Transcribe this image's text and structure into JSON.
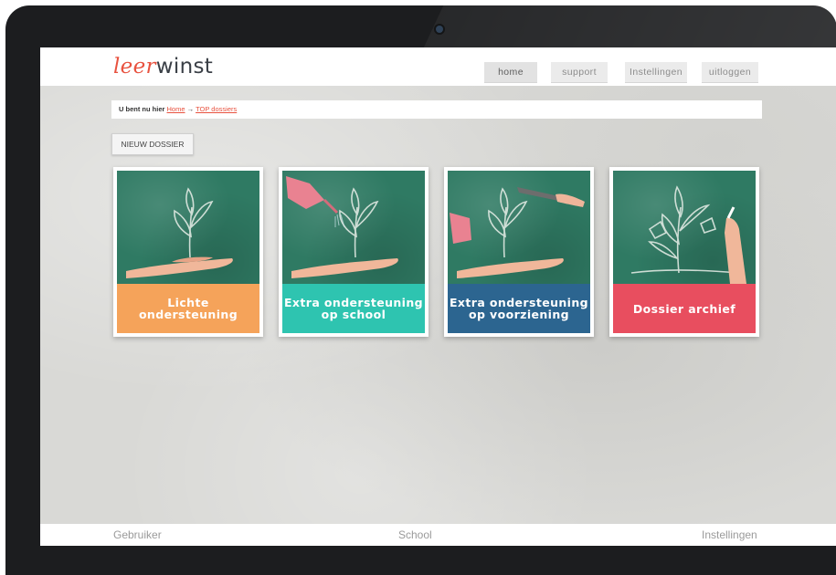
{
  "logo": {
    "accent": "leer",
    "rest": "winst"
  },
  "nav": {
    "home": "home",
    "support": "support",
    "instellingen": "Instellingen",
    "uitloggen": "uitloggen"
  },
  "breadcrumb": {
    "prefix": "U bent nu hier",
    "home_link": "Home",
    "arrow": "→",
    "current_link": "TOP dossiers"
  },
  "actions": {
    "new_dossier": "NIEUW DOSSIER"
  },
  "tiles": [
    {
      "line1": "Lichte ondersteuning",
      "line2": "",
      "color": "#f5a35a"
    },
    {
      "line1": "Extra ondersteuning",
      "line2": "op school",
      "color": "#2ec4b0"
    },
    {
      "line1": "Extra ondersteuning",
      "line2": "op voorziening",
      "color": "#2c6590"
    },
    {
      "line1": "Dossier archief",
      "line2": "",
      "color": "#e84e5f"
    }
  ],
  "footer": {
    "gebruiker": "Gebruiker",
    "school": "School",
    "instellingen": "Instellingen"
  }
}
